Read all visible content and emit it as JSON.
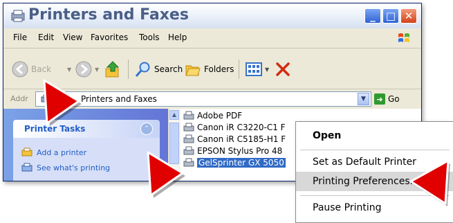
{
  "window": {
    "title": "Printers and Faxes",
    "buttons": {
      "minimize": "_",
      "maximize": "□",
      "close": "✕"
    }
  },
  "menu": {
    "items": [
      "File",
      "Edit",
      "View",
      "Favorites",
      "Tools",
      "Help"
    ]
  },
  "toolbar": {
    "back_label": "Back",
    "search_label": "Search",
    "folders_label": "Folders"
  },
  "address": {
    "label": "Addr",
    "value": "Printers and Faxes",
    "go_label": "Go"
  },
  "tasks": {
    "title": "Printer Tasks",
    "items": [
      "Add a printer",
      "See what's printing"
    ]
  },
  "files": [
    "Adobe PDF",
    "Canon iR C3220-C1 F",
    "Canon iR C5185-H1 F",
    "EPSON Stylus Pro 48",
    "GelSprinter GX 5050"
  ],
  "context_menu": {
    "items": [
      "Open",
      "Set as Default Printer",
      "Printing Preferences...",
      "Pause Printing"
    ]
  },
  "colors": {
    "pointer": "#e00000",
    "selection": "#316ac5"
  }
}
